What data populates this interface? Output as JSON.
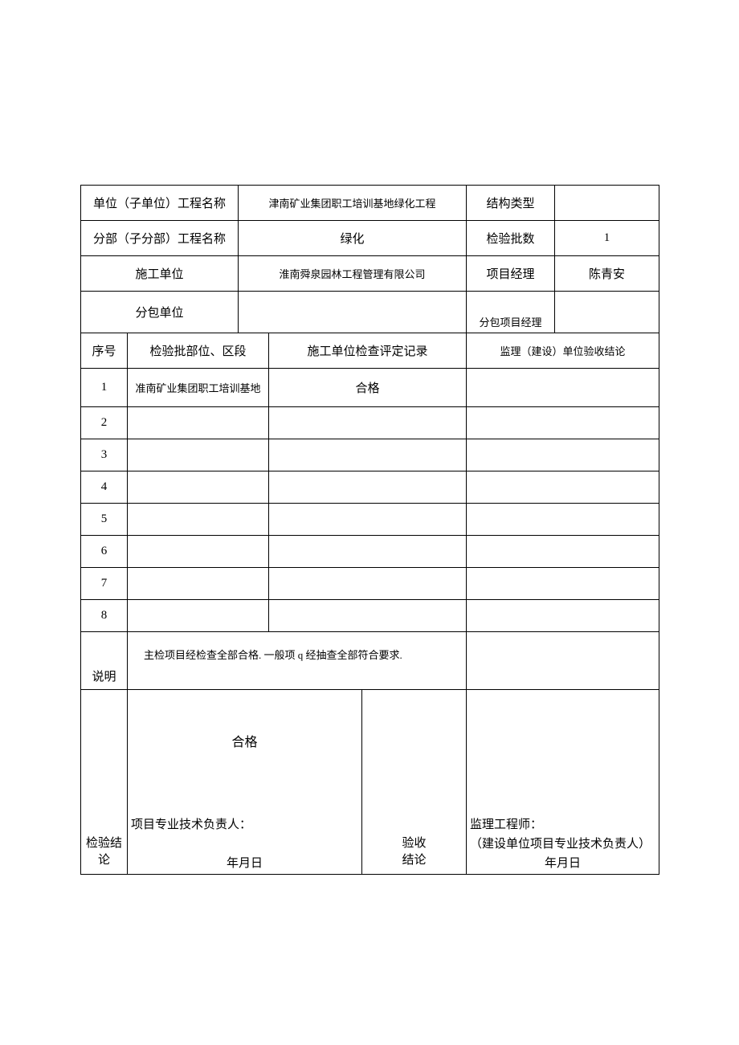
{
  "hdr": {
    "r1c1": "单位（子单位）工程名称",
    "r1c2": "津南矿业集团职工培训基地绿化工程",
    "r1c3": "结构类型",
    "r1c4": "",
    "r2c1": "分部（子分部）工程名称",
    "r2c2": "绿化",
    "r2c3": "检验批数",
    "r2c4": "1",
    "r3c1": "施工单位",
    "r3c2": "淮南舜泉园林工程管理有限公司",
    "r3c3": "项目经理",
    "r3c4": "陈青安",
    "r4c1": "分包单位",
    "r4c2": "",
    "r4c3": "分包项目经理",
    "r4c4": ""
  },
  "th": {
    "c1": "序号",
    "c2": "检验批部位、区段",
    "c3": "施工单位检查评定记录",
    "c4": "监理（建设）单位验收结论"
  },
  "rows": [
    {
      "n": "1",
      "a": "准南矿业集团职工培训基地",
      "b": "合格",
      "c": ""
    },
    {
      "n": "2",
      "a": "",
      "b": "",
      "c": ""
    },
    {
      "n": "3",
      "a": "",
      "b": "",
      "c": ""
    },
    {
      "n": "4",
      "a": "",
      "b": "",
      "c": ""
    },
    {
      "n": "5",
      "a": "",
      "b": "",
      "c": ""
    },
    {
      "n": "6",
      "a": "",
      "b": "",
      "c": ""
    },
    {
      "n": "7",
      "a": "",
      "b": "",
      "c": ""
    },
    {
      "n": "8",
      "a": "",
      "b": "",
      "c": ""
    }
  ],
  "note": {
    "label": "说明",
    "text": "主检项目经检查全部合格. 一般项 q 经抽查全部符合要求."
  },
  "conclusion": {
    "left_label": "检验结\n论",
    "left_result": "合格",
    "left_sig": "项目专业技术负责人：",
    "left_date": "年月日",
    "mid_label": "验收\n结论",
    "right_l1": "监理工程师：",
    "right_l2": "（建设单位项目专业技术负责人）",
    "right_date": "年月日"
  }
}
